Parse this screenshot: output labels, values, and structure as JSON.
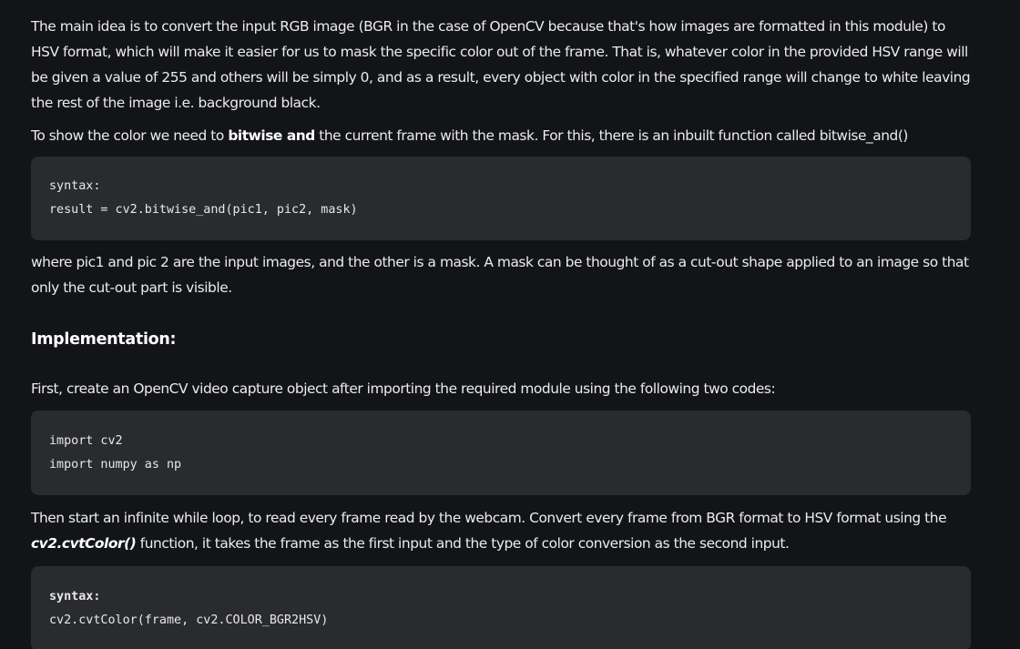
{
  "paragraphs": {
    "intro": "The main idea is to convert the input RGB image (BGR in the case of OpenCV because that's how images are formatted in this module) to HSV format, which will make it easier for us to mask the specific color out of the frame. That is, whatever color in the provided HSV range will be given a value of 255 and others will be simply 0, and as a result, every object with color in the specified range will change to white leaving the rest of the image i.e. background black.",
    "bitwise_before": "To show the color we need to ",
    "bitwise_bold": "bitwise and",
    "bitwise_after": " the current frame with the mask. For this, there is an inbuilt function called bitwise_and()",
    "mask_explain": "where pic1 and pic 2 are the input images, and the other is a mask. A mask can be thought of as a cut-out shape applied to an image so that only the cut-out part is visible.",
    "capture_intro": "First, create an OpenCV video capture object after importing the required module using the following two codes:",
    "loop_before": "Then start an infinite while loop, to read every frame read by the webcam. Convert every frame from BGR format to HSV format using the ",
    "loop_func": "cv2.cvtColor()",
    "loop_after": " function, it takes the frame as the first input and the type of color conversion as the second input."
  },
  "heading": {
    "implementation": "Implementation:"
  },
  "code_blocks": {
    "bitwise": {
      "line1": "syntax:",
      "line2": "result = cv2.bitwise_and(pic1, pic2, mask)"
    },
    "imports": {
      "line1": "import cv2",
      "line2": "import numpy as np"
    },
    "cvtcolor": {
      "line1": "syntax:",
      "line2": "cv2.cvtColor(frame, cv2.COLOR_BGR2HSV)"
    }
  }
}
